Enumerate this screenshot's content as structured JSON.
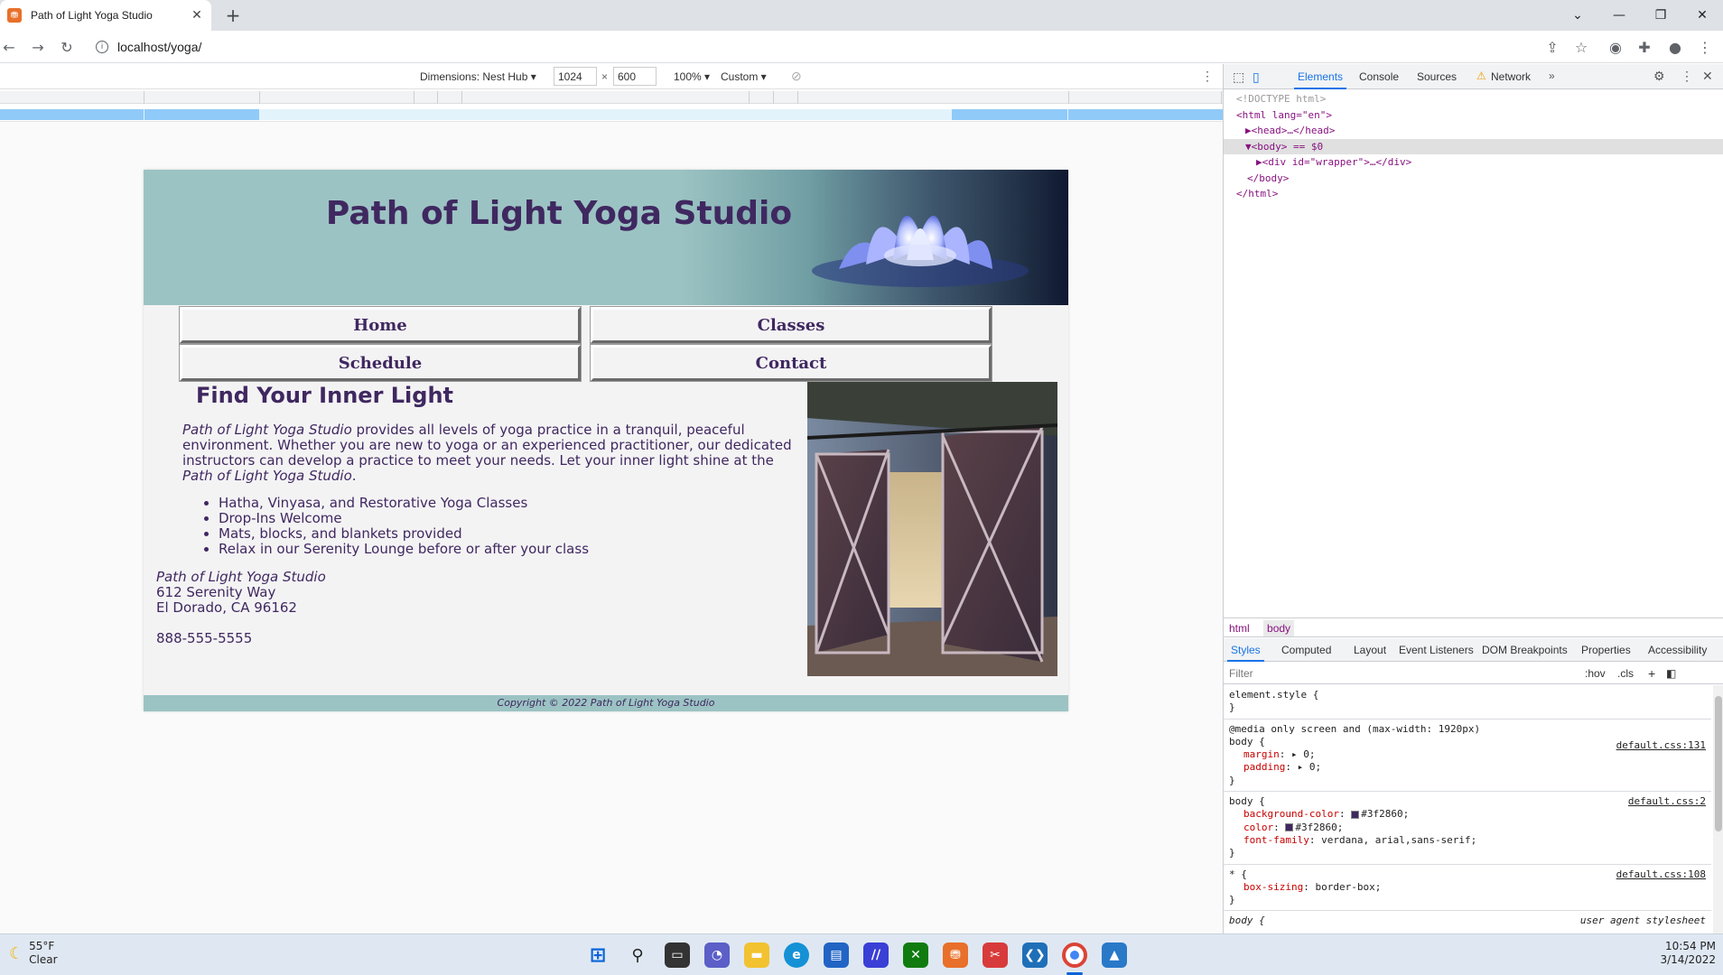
{
  "browser": {
    "tab_title": "Path of Light Yoga Studio",
    "tab_favicon": "xampp-icon",
    "url": "localhost/yoga/"
  },
  "device_toolbar": {
    "dimensions_label": "Dimensions: Nest Hub",
    "width": "1024",
    "height": "600",
    "zoom": "100%",
    "throttle": "Custom"
  },
  "page": {
    "site_title": "Path of Light Yoga Studio",
    "nav": [
      {
        "label": "Home"
      },
      {
        "label": "Classes"
      },
      {
        "label": "Schedule"
      },
      {
        "label": "Contact"
      }
    ],
    "heading": "Find Your Inner Light",
    "intro": {
      "studio_name": "Path of Light Yoga Studio",
      "text_1": " provides all levels of yoga practice in a tranquil, peaceful environment. Whether you are new to yoga or an experienced practitioner, our dedicated instructors can develop a practice to meet your needs. Let your inner light shine at the ",
      "studio_name_2": "Path of Light Yoga Studio",
      "text_2": "."
    },
    "features": [
      "Hatha, Vinyasa, and Restorative Yoga Classes",
      "Drop-Ins Welcome",
      "Mats, blocks, and blankets provided",
      "Relax in our Serenity Lounge before or after your class"
    ],
    "address": {
      "name": "Path of Light Yoga Studio",
      "street": "612 Serenity Way",
      "city": "El Dorado, CA 96162",
      "phone": "888-555-5555"
    },
    "footer": "Copyright © 2022 Path of Light Yoga Studio",
    "colors": {
      "text": "#3f2860",
      "header_bg": "#9cc3c3",
      "page_bg": "#f4f3f4"
    }
  },
  "devtools": {
    "tabs": [
      "Elements",
      "Console",
      "Sources",
      "Network"
    ],
    "dom": [
      "<!DOCTYPE html>",
      "<html lang=\"en\">",
      "▶<head>…</head>",
      "▼<body> == $0",
      "▶<div id=\"wrapper\">…</div>",
      "</body>",
      "</html>"
    ],
    "breadcrumbs": [
      "html",
      "body"
    ],
    "subtabs": [
      "Styles",
      "Computed",
      "Layout",
      "Event Listeners",
      "DOM Breakpoints",
      "Properties",
      "Accessibility"
    ],
    "filter_placeholder": "Filter",
    "filter_tools": [
      ":hov",
      ".cls",
      "+"
    ],
    "rules": {
      "element_style": "element.style {",
      "media": "@media only screen and (max-width: 1920px)",
      "r1_selector": "body {",
      "r1_source": "default.css:131",
      "r1_p1": "margin",
      "r1_v1": "▸ 0;",
      "r1_p2": "padding",
      "r1_v2": "▸ 0;",
      "r2_selector": "body {",
      "r2_source": "default.css:2",
      "r2_p1": "background-color",
      "r2_v1": "#3f2860;",
      "r2_p2": "color",
      "r2_v2": "#3f2860;",
      "r2_p3": "font-family",
      "r2_v3": "verdana, arial,sans-serif;",
      "r3_selector": "* {",
      "r3_source": "default.css:108",
      "r3_p1": "box-sizing",
      "r3_v1": "border-box;",
      "r4_selector": "body {",
      "r4_source": "user agent stylesheet",
      "close": "}"
    }
  },
  "taskbar": {
    "temp": "55°F",
    "condition": "Clear",
    "time": "10:54 PM",
    "date": "3/14/2022"
  }
}
